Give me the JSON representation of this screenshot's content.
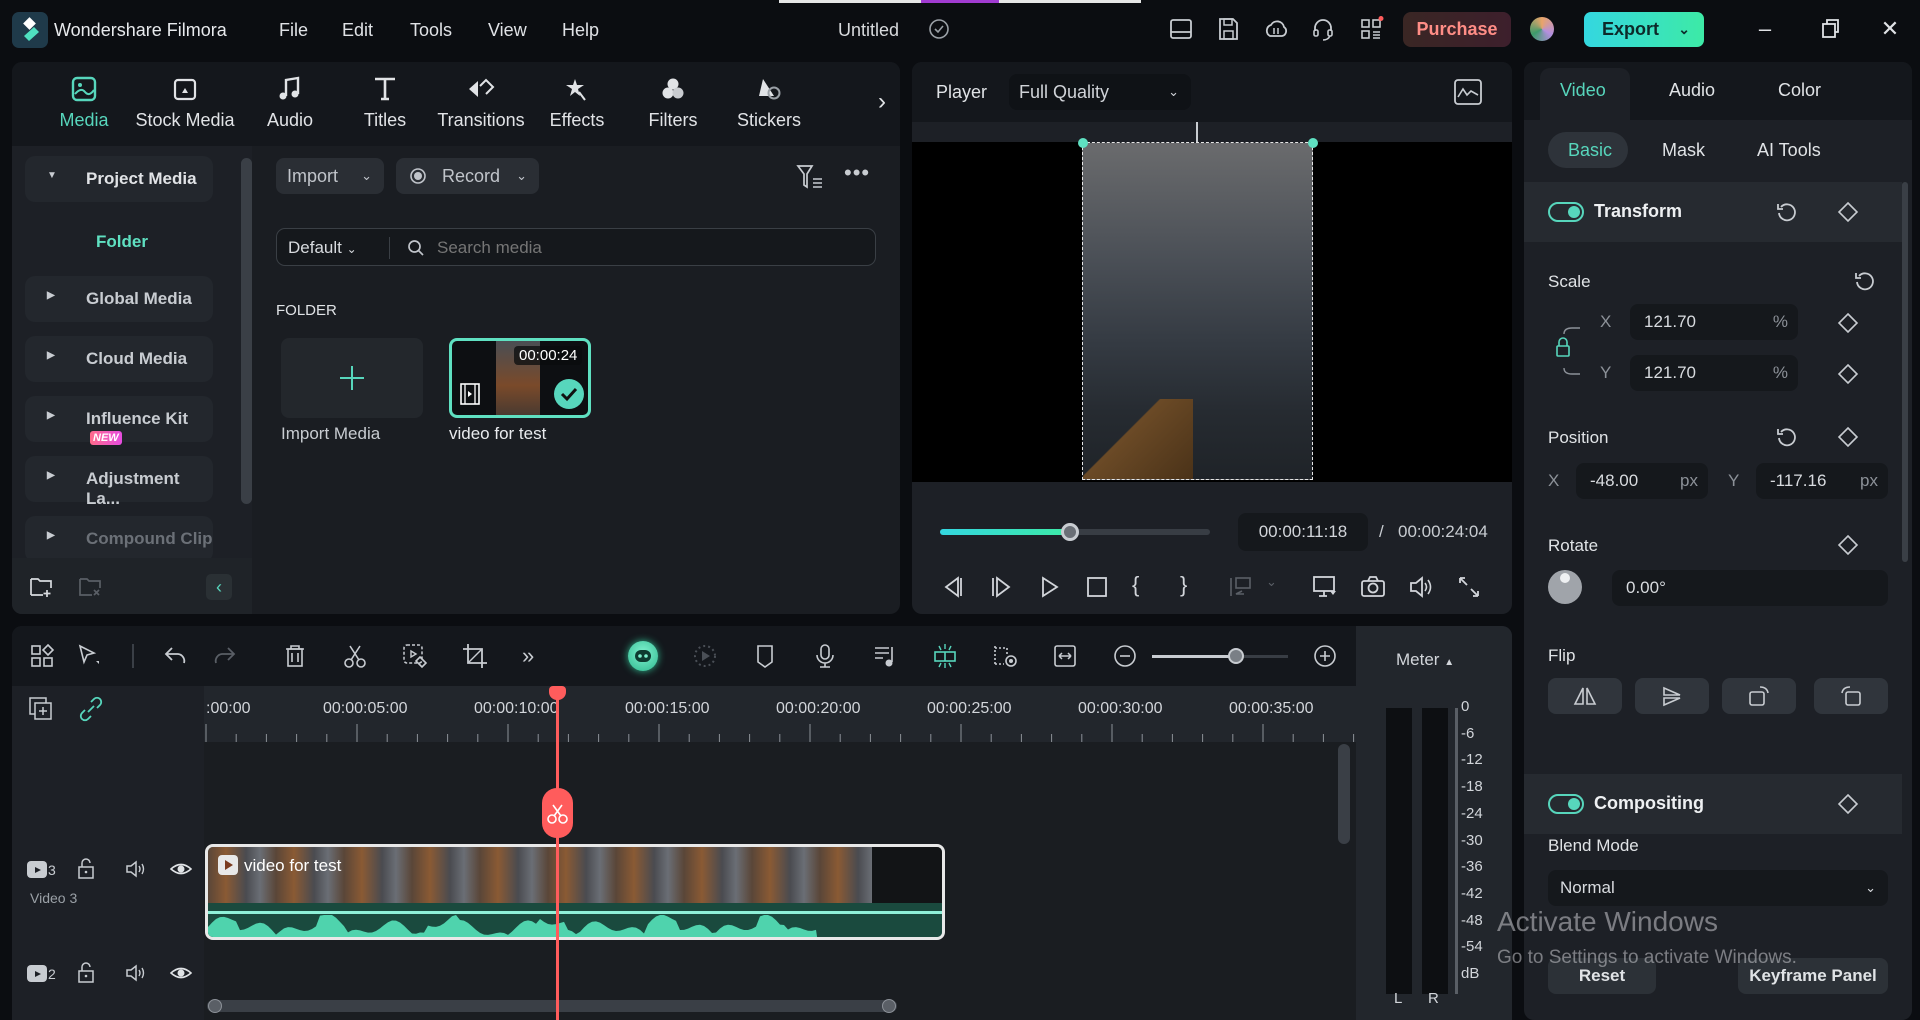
{
  "titlebar": {
    "app_name": "Wondershare Filmora",
    "menu": [
      "File",
      "Edit",
      "Tools",
      "View",
      "Help"
    ],
    "document_title": "Untitled",
    "purchase_label": "Purchase",
    "export_label": "Export",
    "icons": [
      "layout-icon",
      "save-icon",
      "cloud-icon",
      "headset-icon",
      "apps-icon"
    ],
    "window_controls": [
      "minimize",
      "restore",
      "close"
    ]
  },
  "media_tabs": [
    {
      "label": "Media",
      "icon": "media-icon",
      "active": true
    },
    {
      "label": "Stock Media",
      "icon": "stock-media-icon"
    },
    {
      "label": "Audio",
      "icon": "music-note-icon"
    },
    {
      "label": "Titles",
      "icon": "text-icon"
    },
    {
      "label": "Transitions",
      "icon": "transitions-icon"
    },
    {
      "label": "Effects",
      "icon": "effects-star-icon"
    },
    {
      "label": "Filters",
      "icon": "filters-icon"
    },
    {
      "label": "Stickers",
      "icon": "stickers-icon"
    }
  ],
  "sidebar": {
    "project_media": "Project Media",
    "folder": "Folder",
    "items": [
      {
        "label": "Global Media"
      },
      {
        "label": "Cloud Media"
      },
      {
        "label": "Influence Kit",
        "badge": "NEW"
      },
      {
        "label": "Adjustment La..."
      },
      {
        "label": "Compound Clip",
        "disabled": true
      }
    ]
  },
  "media_content": {
    "import_label": "Import",
    "record_label": "Record",
    "sort_label": "Default",
    "search_placeholder": "Search media",
    "section_label": "FOLDER",
    "import_media_label": "Import Media",
    "clip": {
      "name": "video for test",
      "duration": "00:00:24"
    }
  },
  "player": {
    "label": "Player",
    "quality": "Full Quality",
    "current_time": "00:00:11:18",
    "separator": "/",
    "total_time": "00:00:24:04",
    "progress_fraction": 0.48
  },
  "properties": {
    "tabs": [
      "Video",
      "Audio",
      "Color"
    ],
    "active_tab": "Video",
    "subtabs": [
      "Basic",
      "Mask",
      "AI Tools"
    ],
    "active_subtab": "Basic",
    "transform": {
      "title": "Transform",
      "scale_label": "Scale",
      "scale_x": "121.70",
      "scale_y": "121.70",
      "scale_unit": "%",
      "position_label": "Position",
      "position_x": "-48.00",
      "position_y": "-117.16",
      "position_unit": "px",
      "rotate_label": "Rotate",
      "rotate_value": "0.00°",
      "flip_label": "Flip",
      "x_label": "X",
      "y_label": "Y"
    },
    "compositing": {
      "title": "Compositing",
      "blend_mode_label": "Blend Mode",
      "blend_mode": "Normal"
    },
    "reset_label": "Reset",
    "keyframe_label": "Keyframe Panel"
  },
  "timeline": {
    "ruler_labels": [
      ":00:00",
      "00:00:05:00",
      "00:00:10:00",
      "00:00:15:00",
      "00:00:20:00",
      "00:00:25:00",
      "00:00:30:00",
      "00:00:35:00"
    ],
    "tracks": [
      {
        "number": "3",
        "name": "Video 3"
      },
      {
        "number": "2",
        "name": ""
      }
    ],
    "clip_label": "video for test",
    "zoom_fraction": 0.5
  },
  "meter": {
    "title": "Meter",
    "scale": [
      "0",
      "-6",
      "-12",
      "-18",
      "-24",
      "-30",
      "-36",
      "-42",
      "-48",
      "-54",
      "dB"
    ],
    "channels": [
      "L",
      "R"
    ]
  },
  "watermark": {
    "line1": "Activate Windows",
    "line2": "Go to Settings to activate Windows."
  },
  "colors": {
    "accent": "#57d6bc",
    "playhead": "#ff5c5c",
    "purchase": "#ff8d86",
    "export_start": "#34d7e0",
    "export_end": "#3deaa6"
  }
}
